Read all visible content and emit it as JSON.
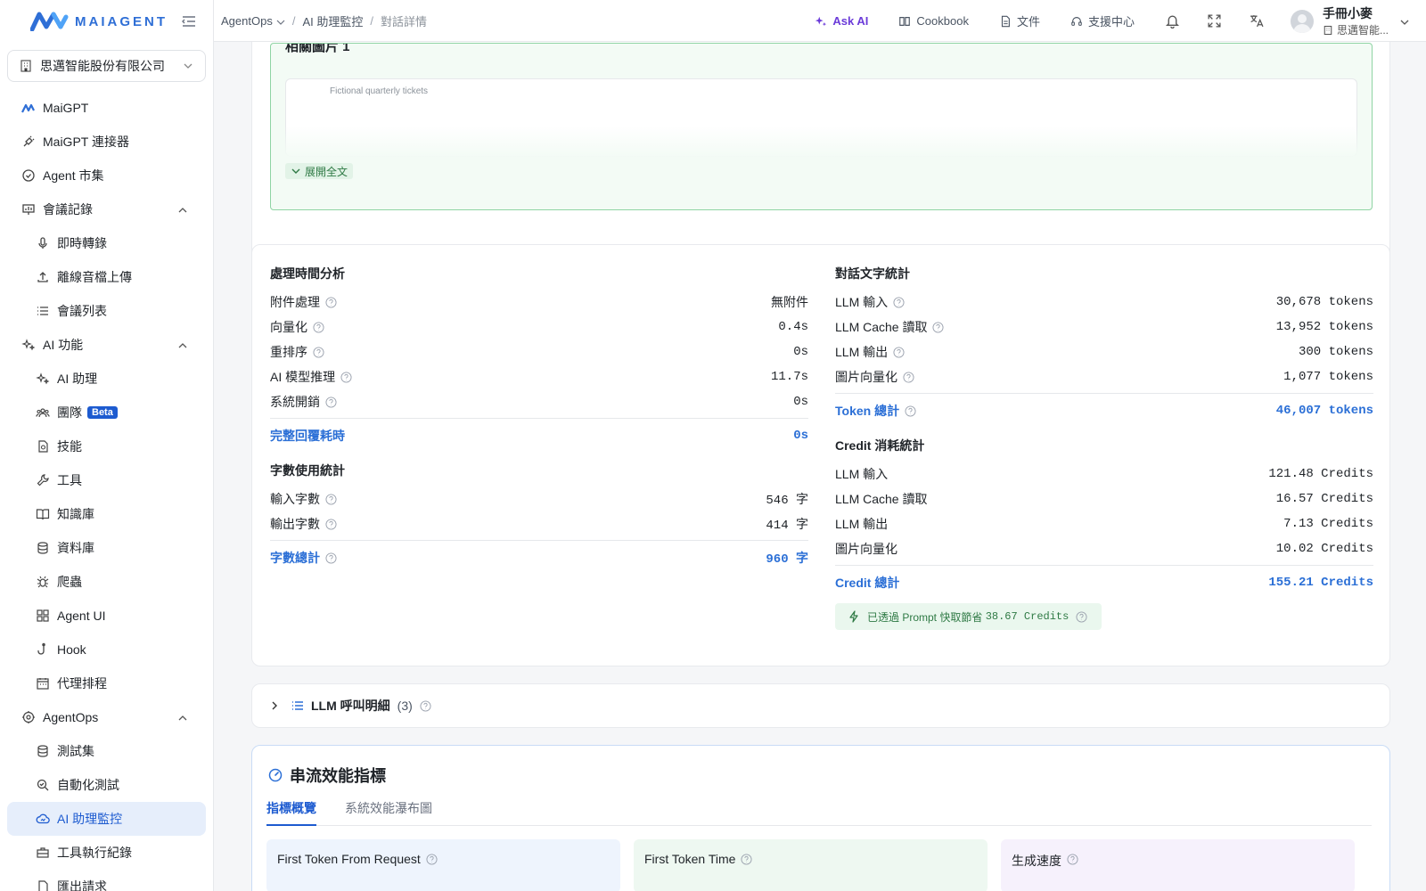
{
  "brand": {
    "logo_text": "MAIAGENT"
  },
  "sidebar": {
    "org_name": "思邁智能股份有限公司",
    "items": [
      {
        "label": "MaiGPT"
      },
      {
        "label": "MaiGPT 連接器"
      },
      {
        "label": "Agent 市集"
      },
      {
        "label": "會議記錄"
      },
      {
        "label": "即時轉錄"
      },
      {
        "label": "離線音檔上傳"
      },
      {
        "label": "會議列表"
      },
      {
        "label": "AI 功能"
      },
      {
        "label": "AI 助理"
      },
      {
        "label": "團隊",
        "badge": "Beta"
      },
      {
        "label": "技能"
      },
      {
        "label": "工具"
      },
      {
        "label": "知識庫"
      },
      {
        "label": "資料庫"
      },
      {
        "label": "爬蟲"
      },
      {
        "label": "Agent UI"
      },
      {
        "label": "Hook"
      },
      {
        "label": "代理排程"
      },
      {
        "label": "AgentOps"
      },
      {
        "label": "測試集"
      },
      {
        "label": "自動化測試"
      },
      {
        "label": "AI 助理監控"
      },
      {
        "label": "工具執行紀錄"
      },
      {
        "label": "匯出請求"
      }
    ]
  },
  "header": {
    "breadcrumb": [
      "AgentOps",
      "AI 助理監控",
      "對話詳情"
    ],
    "ask_ai": "Ask AI",
    "cookbook": "Cookbook",
    "docs": "文件",
    "support": "支援中心",
    "user_name": "手冊小麥",
    "user_org": "思邁智能..."
  },
  "image_card": {
    "title": "相關圖片 1",
    "caption": "Fictional quarterly tickets",
    "expand_label": "展開全文"
  },
  "processing": {
    "title": "處理時間分析",
    "rows": [
      {
        "label": "附件處理",
        "value": "無附件"
      },
      {
        "label": "向量化",
        "value": "0.4s"
      },
      {
        "label": "重排序",
        "value": "0s"
      },
      {
        "label": "AI 模型推理",
        "value": "11.7s"
      },
      {
        "label": "系統開銷",
        "value": "0s"
      }
    ],
    "total_label": "完整回覆耗時",
    "total_value": "0s"
  },
  "chars": {
    "title": "字數使用統計",
    "rows": [
      {
        "label": "輸入字數",
        "value": "546 字"
      },
      {
        "label": "輸出字數",
        "value": "414 字"
      }
    ],
    "total_label": "字數總計",
    "total_value": "960 字"
  },
  "tokens": {
    "title": "對話文字統計",
    "rows": [
      {
        "label": "LLM 輸入",
        "value": "30,678 tokens"
      },
      {
        "label": "LLM Cache 讀取",
        "value": "13,952 tokens"
      },
      {
        "label": "LLM 輸出",
        "value": "300 tokens"
      },
      {
        "label": "圖片向量化",
        "value": "1,077 tokens"
      }
    ],
    "total_label": "Token 總計",
    "total_value": "46,007 tokens"
  },
  "credits": {
    "title": "Credit 消耗統計",
    "rows": [
      {
        "label": "LLM 輸入",
        "value": "121.48 Credits"
      },
      {
        "label": "LLM Cache 讀取",
        "value": "16.57 Credits"
      },
      {
        "label": "LLM 輸出",
        "value": "7.13 Credits"
      },
      {
        "label": "圖片向量化",
        "value": "10.02 Credits"
      }
    ],
    "total_label": "Credit 總計",
    "total_value": "155.21 Credits",
    "saving_label": "已透過 Prompt 快取節省",
    "saving_value": "38.67 Credits"
  },
  "llm_calls": {
    "title": "LLM 呼叫明細",
    "count": "(3)"
  },
  "stream": {
    "title": "串流效能指標",
    "tabs": [
      "指標概覽",
      "系統效能瀑布圖"
    ],
    "metrics": [
      "First Token From Request",
      "First Token Time",
      "生成速度"
    ]
  }
}
